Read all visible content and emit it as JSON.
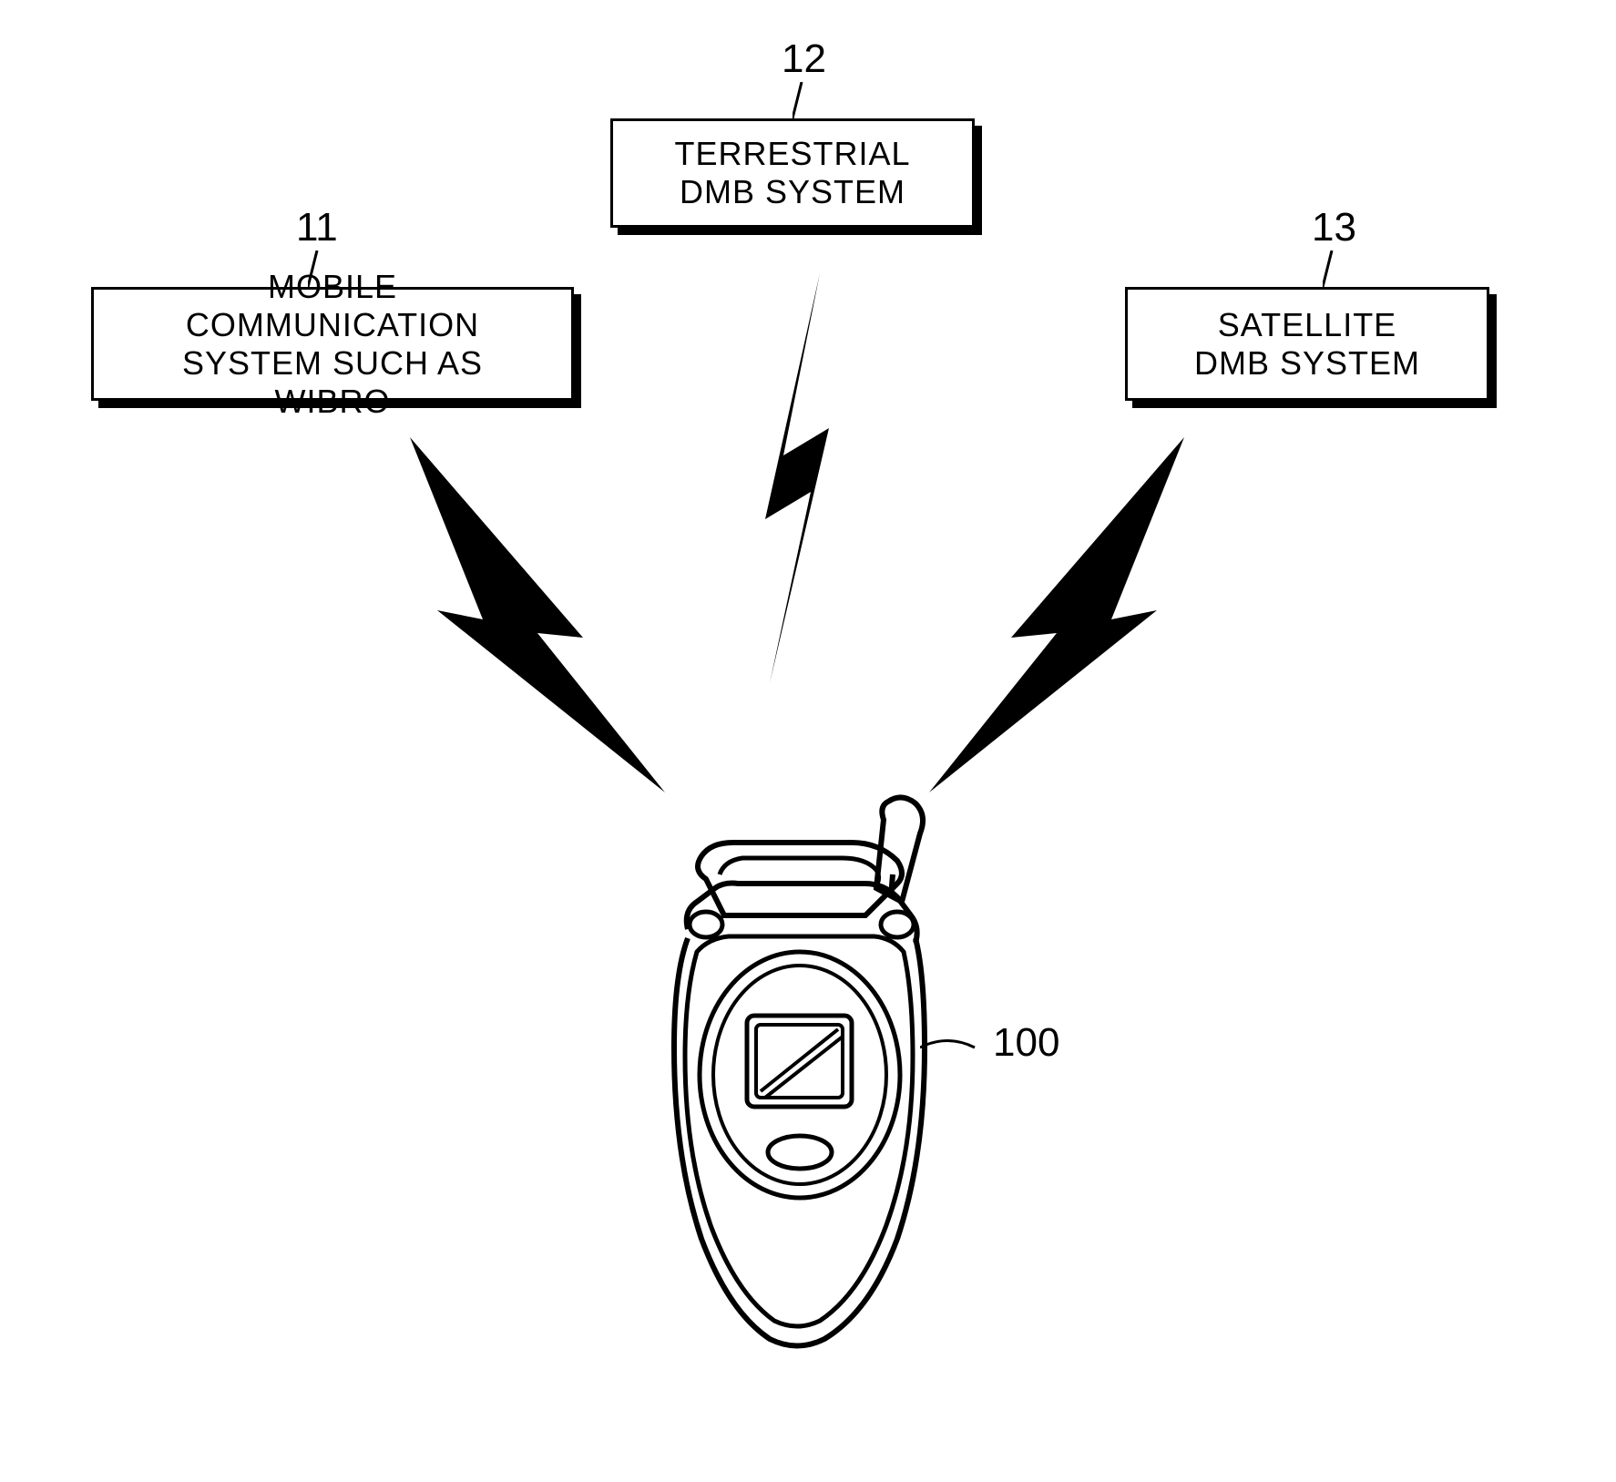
{
  "systems": {
    "left": {
      "ref": "11",
      "label": "MOBILE COMMUNICATION\nSYSTEM SUCH AS WIBRO"
    },
    "center": {
      "ref": "12",
      "label": "TERRESTRIAL\nDMB SYSTEM"
    },
    "right": {
      "ref": "13",
      "label": "SATELLITE\nDMB SYSTEM"
    }
  },
  "phone": {
    "ref": "100"
  }
}
